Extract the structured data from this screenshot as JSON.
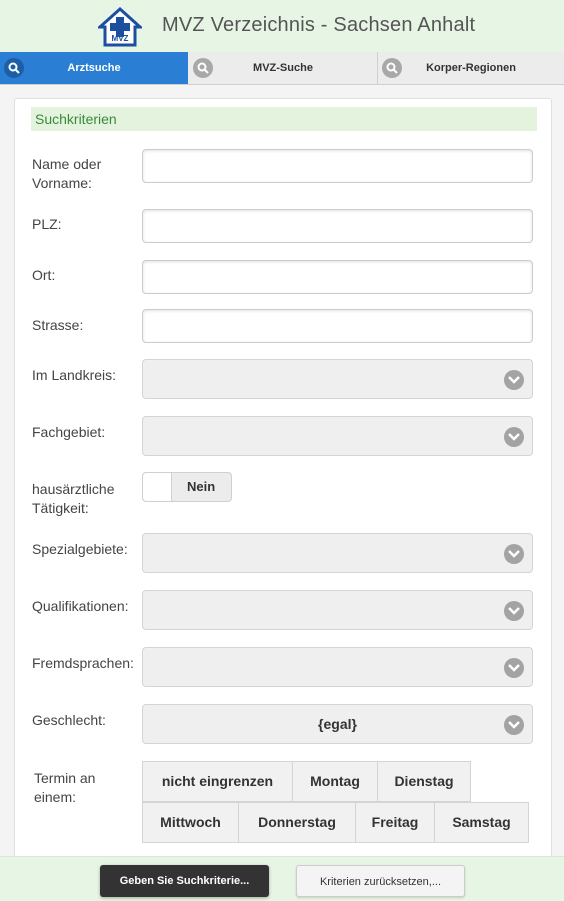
{
  "header": {
    "title": "MVZ Verzeichnis - Sachsen Anhalt",
    "logo_text": "MVZ",
    "logo_icon": "house-cross-logo-icon"
  },
  "tabs": [
    {
      "label": "Arztsuche",
      "icon": "search-icon",
      "active": true
    },
    {
      "label": "MVZ-Suche",
      "icon": "search-icon",
      "active": false
    },
    {
      "label": "Korper-Regionen",
      "icon": "search-icon",
      "active": false
    }
  ],
  "section_title": "Suchkriterien",
  "fields": {
    "name": {
      "label": "Name oder Vorname:",
      "value": ""
    },
    "plz": {
      "label": "PLZ:",
      "value": ""
    },
    "ort": {
      "label": "Ort:",
      "value": ""
    },
    "strasse": {
      "label": "Strasse:",
      "value": ""
    },
    "landkreis": {
      "label": "Im Landkreis:",
      "value": ""
    },
    "fachgebiet": {
      "label": "Fachgebiet:",
      "value": ""
    },
    "hausarzt": {
      "label": "hausärztliche Tätigkeit:",
      "value": "Nein"
    },
    "spezialgebiete": {
      "label": "Spezialgebiete:",
      "value": ""
    },
    "qualifikationen": {
      "label": "Qualifikationen:",
      "value": ""
    },
    "fremdsprachen": {
      "label": "Fremdsprachen:",
      "value": ""
    },
    "geschlecht": {
      "label": "Geschlecht:",
      "value": "{egal}"
    },
    "termin": {
      "label": "Termin an einem:"
    }
  },
  "days": [
    "nicht eingrenzen",
    "Montag",
    "Dienstag",
    "Mittwoch",
    "Donnerstag",
    "Freitag",
    "Samstag"
  ],
  "footer": {
    "search_label": "Geben Sie Suchkriterie...",
    "reset_label": "Kriterien zurücksetzen,..."
  },
  "colors": {
    "active_tab": "#2a7fd4",
    "header_bg": "#e6f5e4",
    "section_title_text": "#3a8a3a"
  }
}
